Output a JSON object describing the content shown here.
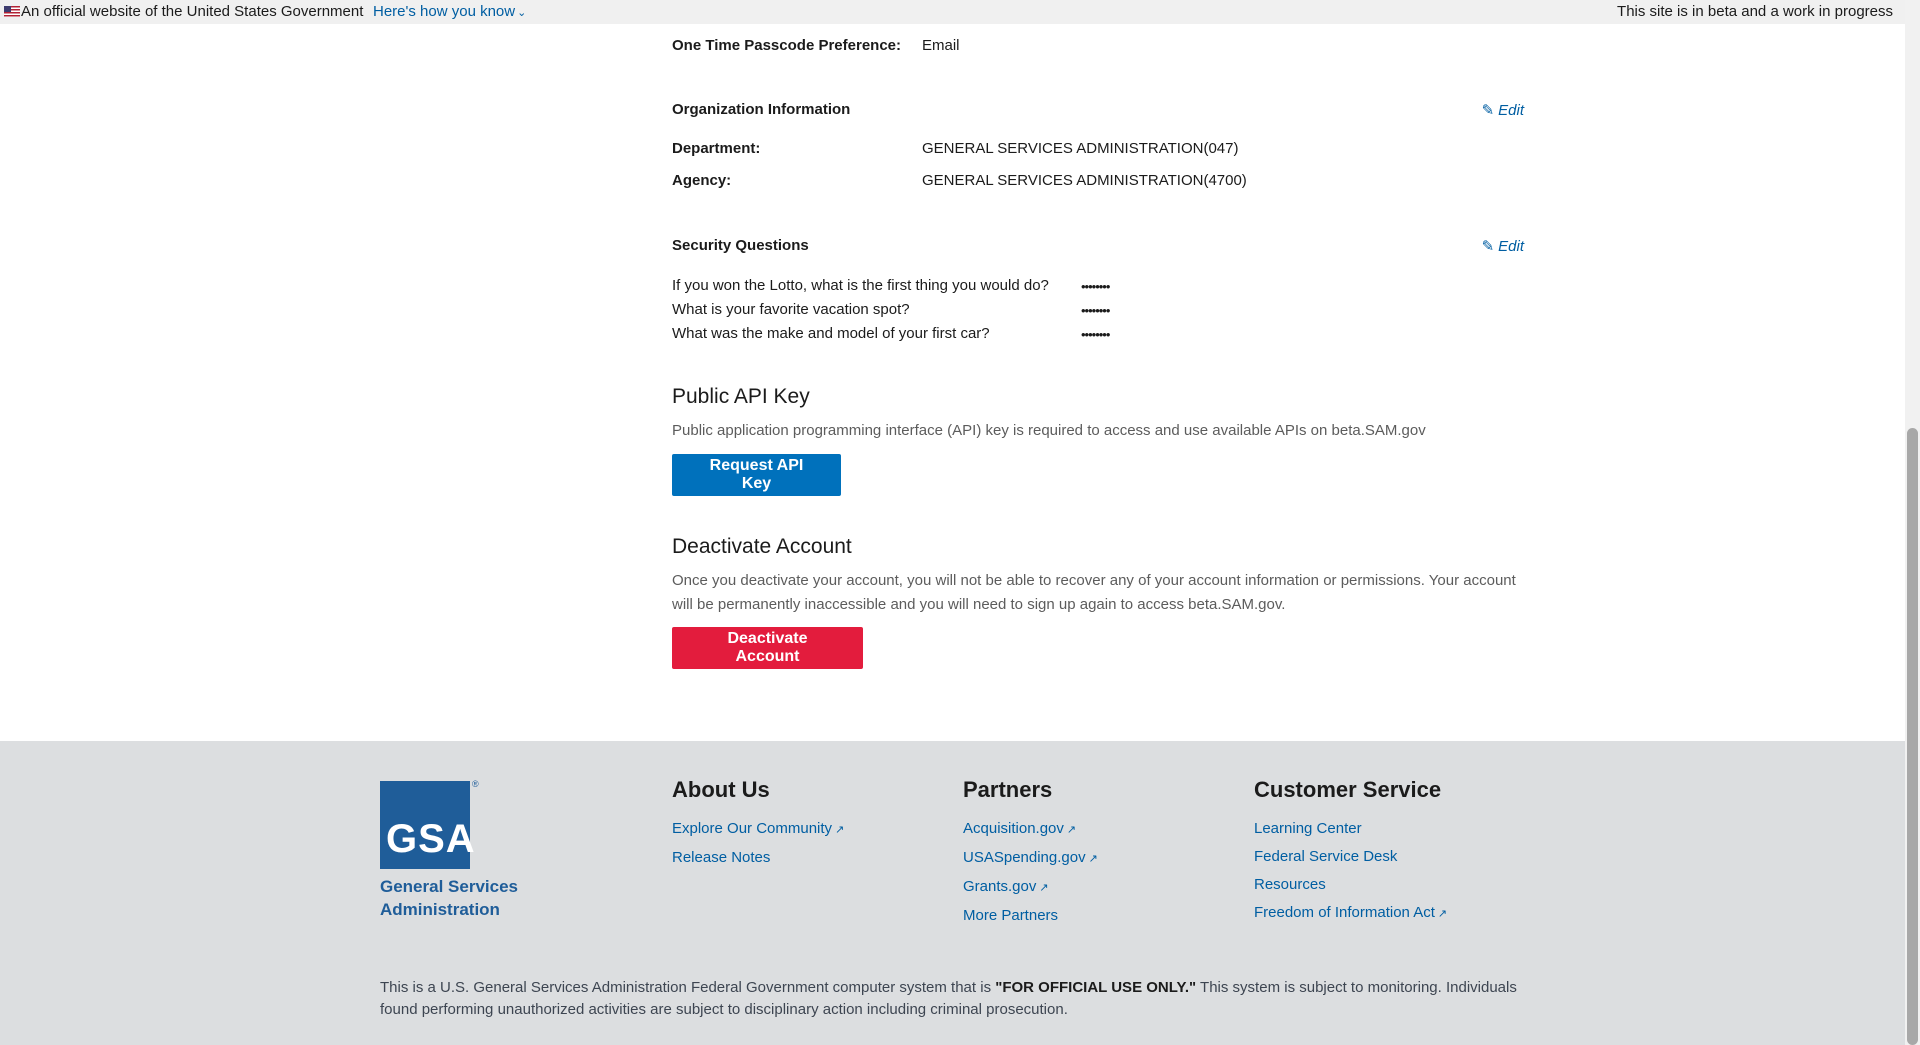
{
  "banner": {
    "official_text": "An official website of the United States Government",
    "how_link": "Here's how you know",
    "beta_note": "This site is in beta and a work in progress"
  },
  "profile": {
    "otp_label": "One Time Passcode Preference:",
    "otp_value": "Email"
  },
  "organization": {
    "title": "Organization Information",
    "edit_label": "Edit",
    "department_label": "Department:",
    "department_value": "GENERAL SERVICES ADMINISTRATION(047)",
    "agency_label": "Agency:",
    "agency_value": "GENERAL SERVICES ADMINISTRATION(4700)"
  },
  "security": {
    "title": "Security Questions",
    "edit_label": "Edit",
    "questions": [
      {
        "q": "If you won the Lotto, what is the first thing you would do?",
        "a": "••••••••"
      },
      {
        "q": "What is your favorite vacation spot?",
        "a": "••••••••"
      },
      {
        "q": "What was the make and model of your first car?",
        "a": "••••••••"
      }
    ]
  },
  "api_key": {
    "title": "Public API Key",
    "description": "Public application programming interface (API) key is required to access and use available APIs on beta.SAM.gov",
    "button": "Request API Key"
  },
  "deactivate": {
    "title": "Deactivate Account",
    "description": "Once you deactivate your account, you will not be able to recover any of your account information or permissions. Your account will be permanently inaccessible and you will need to sign up again to access beta.SAM.gov.",
    "button": "Deactivate Account"
  },
  "footer": {
    "logo_text": "GSA",
    "logo_name": "General Services Administration",
    "about": {
      "title": "About Us",
      "links": [
        "Explore Our Community",
        "Release Notes"
      ]
    },
    "partners": {
      "title": "Partners",
      "links": [
        "Acquisition.gov",
        "USASpending.gov",
        "Grants.gov",
        "More Partners"
      ]
    },
    "customer_service": {
      "title": "Customer Service",
      "links": [
        "Learning Center",
        "Federal Service Desk",
        "Resources",
        "Freedom of Information Act"
      ]
    },
    "disclaimer_pre": "This is a U.S. General Services Administration Federal Government computer system that is ",
    "disclaimer_bold": "\"FOR OFFICIAL USE ONLY.\"",
    "disclaimer_post": " This system is subject to monitoring. Individuals found performing unauthorized activities are subject to disciplinary action including criminal prosecution."
  },
  "icons": {
    "edit": "pencil-icon",
    "external": "external-link-icon",
    "flag": "us-flag-icon",
    "chevron": "chevron-down-icon"
  },
  "colors": {
    "link": "#005ea2",
    "primary_button": "#0071bc",
    "danger_button": "#e31c3d",
    "footer_bg": "#dcdee0",
    "gsa_blue": "#1f5d99"
  }
}
